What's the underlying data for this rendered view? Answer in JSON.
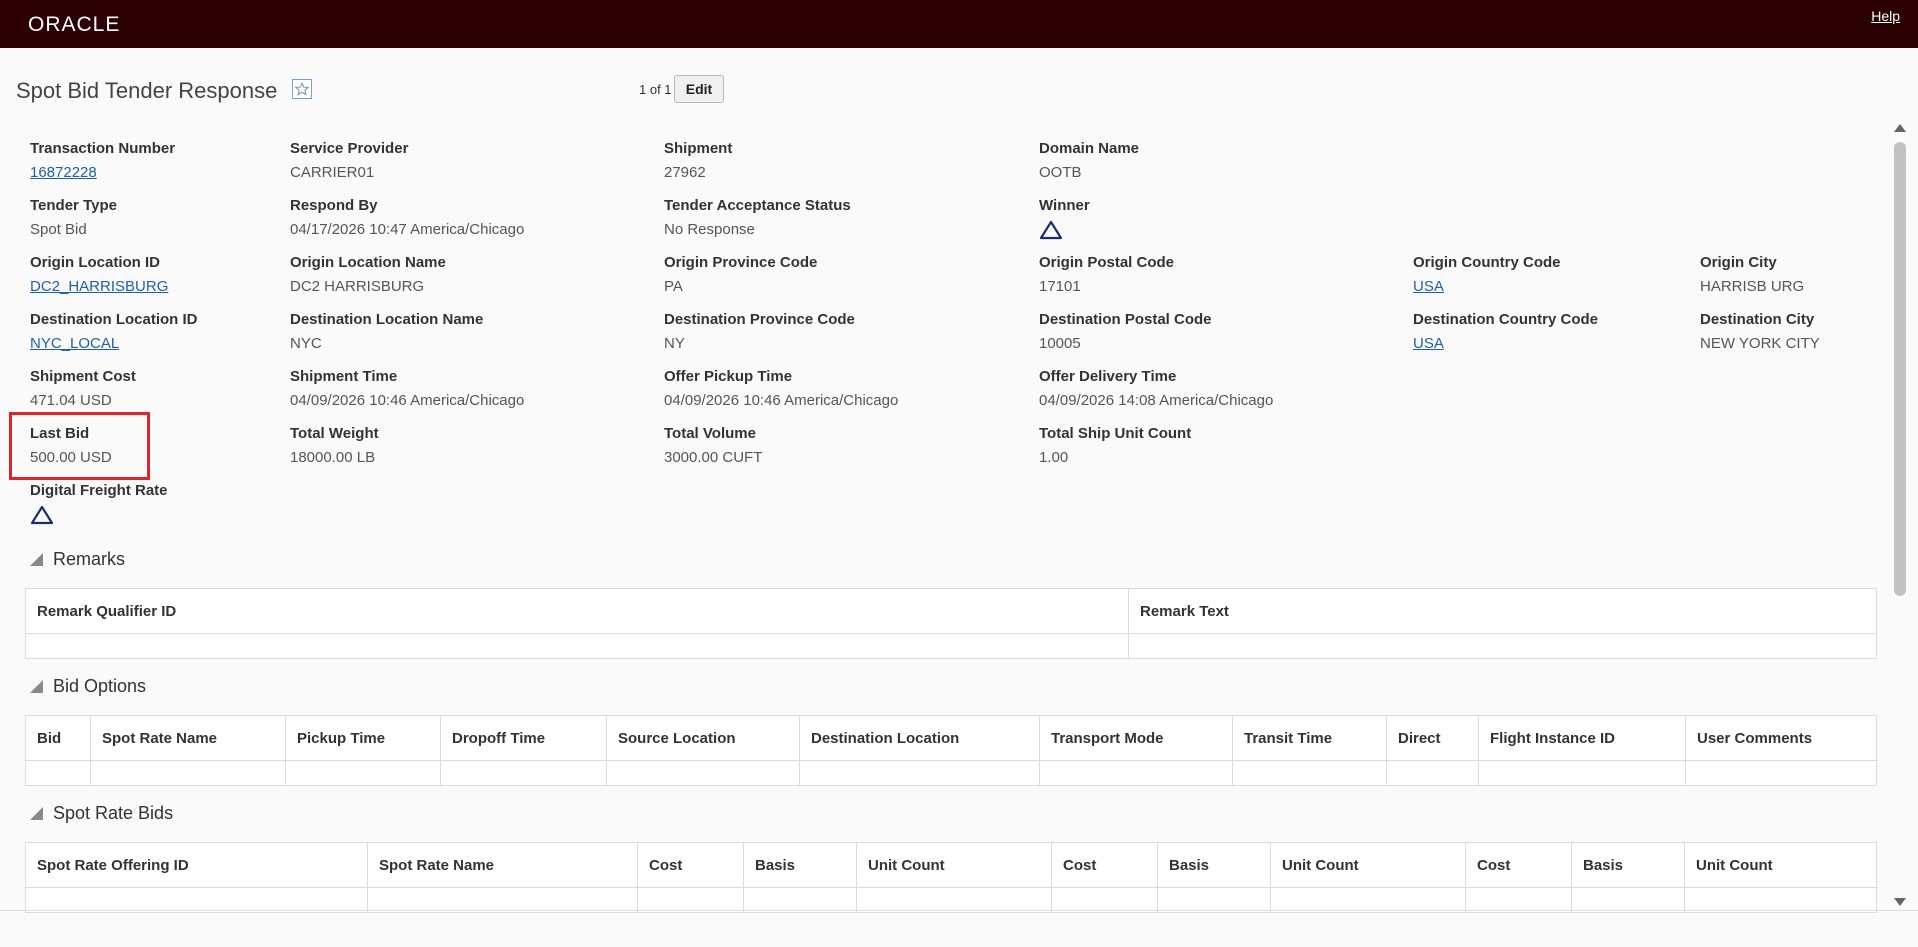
{
  "header": {
    "logo_text": "ORACLE",
    "help_label": "Help"
  },
  "page": {
    "title": "Spot Bid Tender Response",
    "pager": "1 of 1",
    "edit_label": "Edit"
  },
  "fields": {
    "transaction_number": {
      "label": "Transaction Number",
      "value": "16872228"
    },
    "service_provider": {
      "label": "Service Provider",
      "value": "CARRIER01"
    },
    "shipment": {
      "label": "Shipment",
      "value": "27962"
    },
    "domain_name": {
      "label": "Domain Name",
      "value": "OOTB"
    },
    "tender_type": {
      "label": "Tender Type",
      "value": "Spot Bid"
    },
    "respond_by": {
      "label": "Respond By",
      "value": "04/17/2026 10:47 America/Chicago"
    },
    "tender_acceptance_status": {
      "label": "Tender Acceptance Status",
      "value": "No Response"
    },
    "winner": {
      "label": "Winner"
    },
    "origin_location_id": {
      "label": "Origin Location ID",
      "value": "DC2_HARRISBURG"
    },
    "origin_location_name": {
      "label": "Origin Location Name",
      "value": "DC2 HARRISBURG"
    },
    "origin_province_code": {
      "label": "Origin Province Code",
      "value": "PA"
    },
    "origin_postal_code": {
      "label": "Origin Postal Code",
      "value": "17101"
    },
    "origin_country_code": {
      "label": "Origin Country Code",
      "value": "USA"
    },
    "origin_city": {
      "label": "Origin City",
      "value": "HARRISB URG"
    },
    "destination_location_id": {
      "label": "Destination Location ID",
      "value": "NYC_LOCAL"
    },
    "destination_location_name": {
      "label": "Destination Location Name",
      "value": "NYC"
    },
    "destination_province_code": {
      "label": "Destination Province Code",
      "value": "NY"
    },
    "destination_postal_code": {
      "label": "Destination Postal Code",
      "value": "10005"
    },
    "destination_country_code": {
      "label": "Destination Country Code",
      "value": "USA"
    },
    "destination_city": {
      "label": "Destination City",
      "value": "NEW YORK CITY"
    },
    "shipment_cost": {
      "label": "Shipment Cost",
      "value": "471.04 USD"
    },
    "shipment_time": {
      "label": "Shipment Time",
      "value": "04/09/2026 10:46 America/Chicago"
    },
    "offer_pickup_time": {
      "label": "Offer Pickup Time",
      "value": "04/09/2026 10:46 America/Chicago"
    },
    "offer_delivery_time": {
      "label": "Offer Delivery Time",
      "value": "04/09/2026 14:08 America/Chicago"
    },
    "last_bid": {
      "label": "Last Bid",
      "value": "500.00 USD"
    },
    "total_weight": {
      "label": "Total Weight",
      "value": "18000.00 LB"
    },
    "total_volume": {
      "label": "Total Volume",
      "value": "3000.00 CUFT"
    },
    "total_ship_unit_count": {
      "label": "Total Ship Unit Count",
      "value": "1.00"
    },
    "digital_freight_rate": {
      "label": "Digital Freight Rate"
    }
  },
  "sections": {
    "remarks": {
      "title": "Remarks",
      "columns": [
        "Remark Qualifier ID",
        "Remark Text"
      ]
    },
    "bid_options": {
      "title": "Bid Options",
      "columns": [
        "Bid",
        "Spot Rate Name",
        "Pickup Time",
        "Dropoff Time",
        "Source Location",
        "Destination Location",
        "Transport Mode",
        "Transit Time",
        "Direct",
        "Flight Instance ID",
        "User Comments"
      ]
    },
    "spot_rate_bids": {
      "title": "Spot Rate Bids",
      "columns": [
        "Spot Rate Offering ID",
        "Spot Rate Name",
        "Cost",
        "Basis",
        "Unit Count",
        "Cost",
        "Basis",
        "Unit Count",
        "Cost",
        "Basis",
        "Unit Count"
      ]
    }
  },
  "colors": {
    "brand_bar": "#2a0002",
    "link": "#1f5fa8",
    "highlight": "#e0242a",
    "icon": "#1a2d6e"
  }
}
